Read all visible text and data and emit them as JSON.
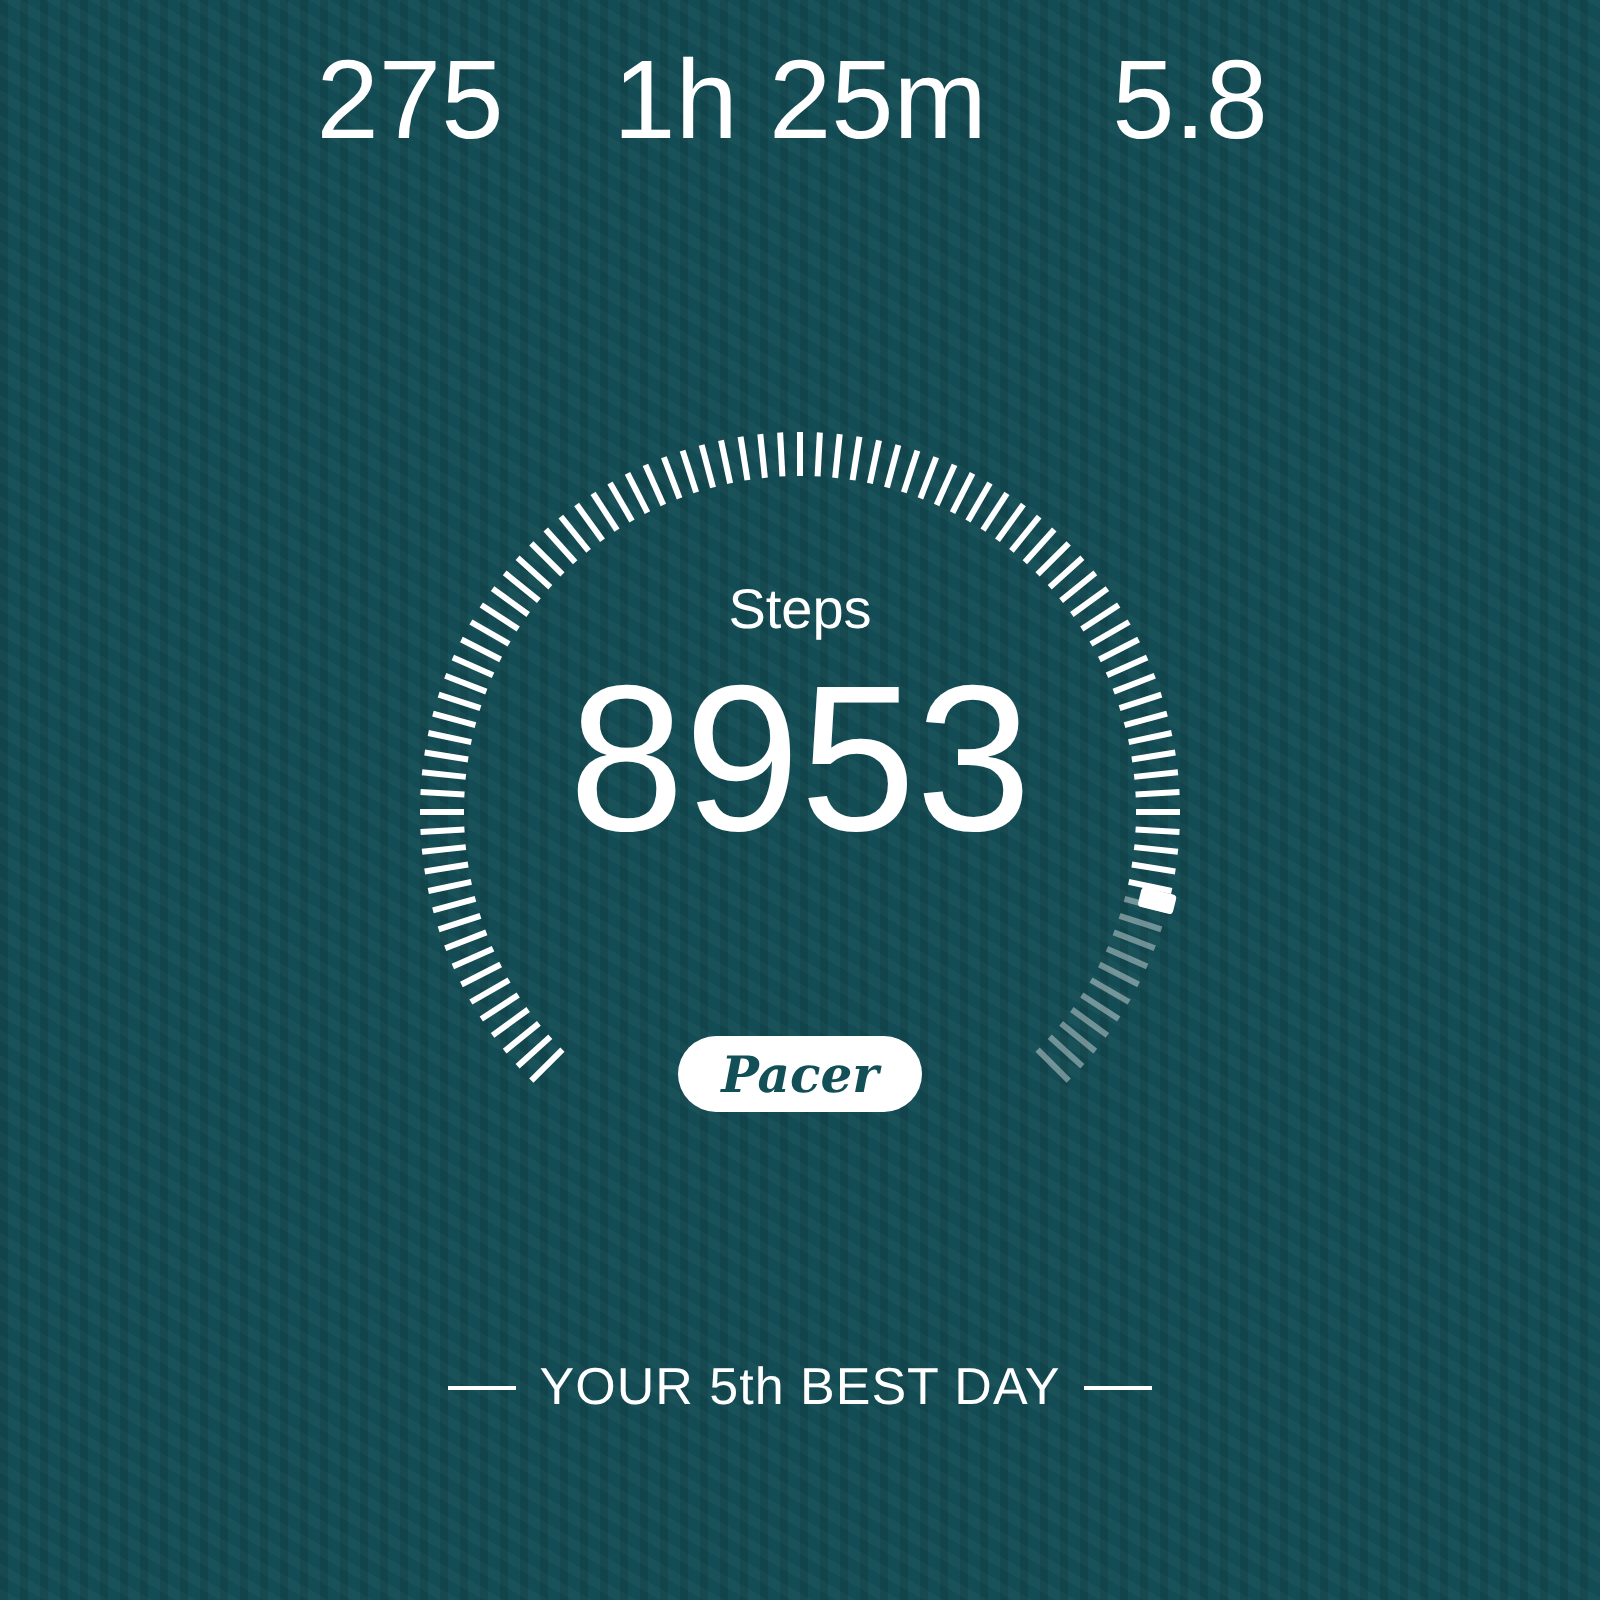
{
  "stats": [
    {
      "value": "275"
    },
    {
      "value": "1h 25m"
    },
    {
      "value": "5.8"
    }
  ],
  "gauge": {
    "label": "Steps",
    "value": "8953",
    "level": 0.885
  },
  "logo": "Pacer",
  "footer": "YOUR 5th BEST DAY"
}
